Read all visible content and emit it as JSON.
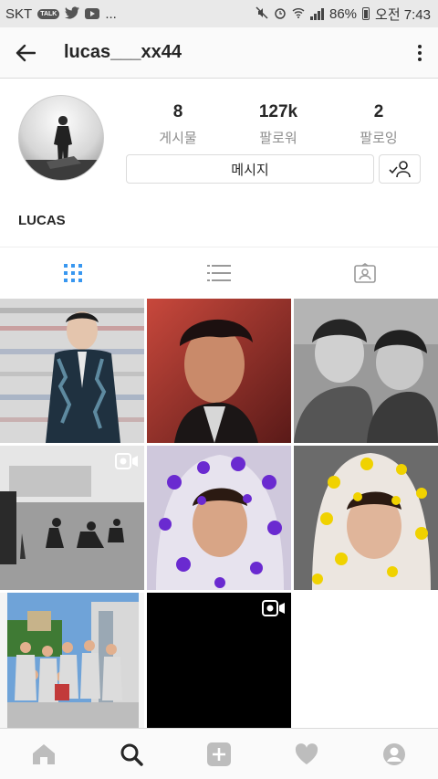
{
  "status_bar": {
    "carrier": "SKT",
    "talk_badge": "TALK",
    "overflow": "...",
    "battery": "86%",
    "time": "오전 7:43"
  },
  "header": {
    "username": "lucas___xx44"
  },
  "profile": {
    "stats": [
      {
        "value": "8",
        "label": "게시물"
      },
      {
        "value": "127k",
        "label": "팔로워"
      },
      {
        "value": "2",
        "label": "팔로잉"
      }
    ],
    "message_button": "메시지",
    "full_name": "LUCAS"
  },
  "tabs": [
    "grid-icon",
    "list-icon",
    "tagged-icon"
  ],
  "grid": {
    "posts": [
      {
        "kind": "photo",
        "palette": [
          "#1e2b3a",
          "#c9c9c9"
        ]
      },
      {
        "kind": "photo",
        "palette": [
          "#b2413a",
          "#2a1414"
        ]
      },
      {
        "kind": "photo",
        "palette": [
          "#9a9a9a",
          "#303030"
        ]
      },
      {
        "kind": "video",
        "palette": [
          "#cfcfcf",
          "#3a3a3a"
        ]
      },
      {
        "kind": "photo",
        "palette": [
          "#d9d2e6",
          "#6a2ad0"
        ]
      },
      {
        "kind": "photo",
        "palette": [
          "#e7dfd8",
          "#f0d200"
        ]
      },
      {
        "kind": "photo",
        "palette": [
          "#6fa3d8",
          "#2f6b2a"
        ]
      },
      {
        "kind": "video",
        "palette": [
          "#000000",
          "#000000"
        ]
      }
    ]
  },
  "colors": {
    "accent": "#3897f0",
    "text": "#262626",
    "muted": "#8e8e8e",
    "border": "#dbdbdb"
  },
  "bottom_nav": [
    "home-icon",
    "search-icon",
    "add-post-icon",
    "activity-heart-icon",
    "profile-icon"
  ]
}
